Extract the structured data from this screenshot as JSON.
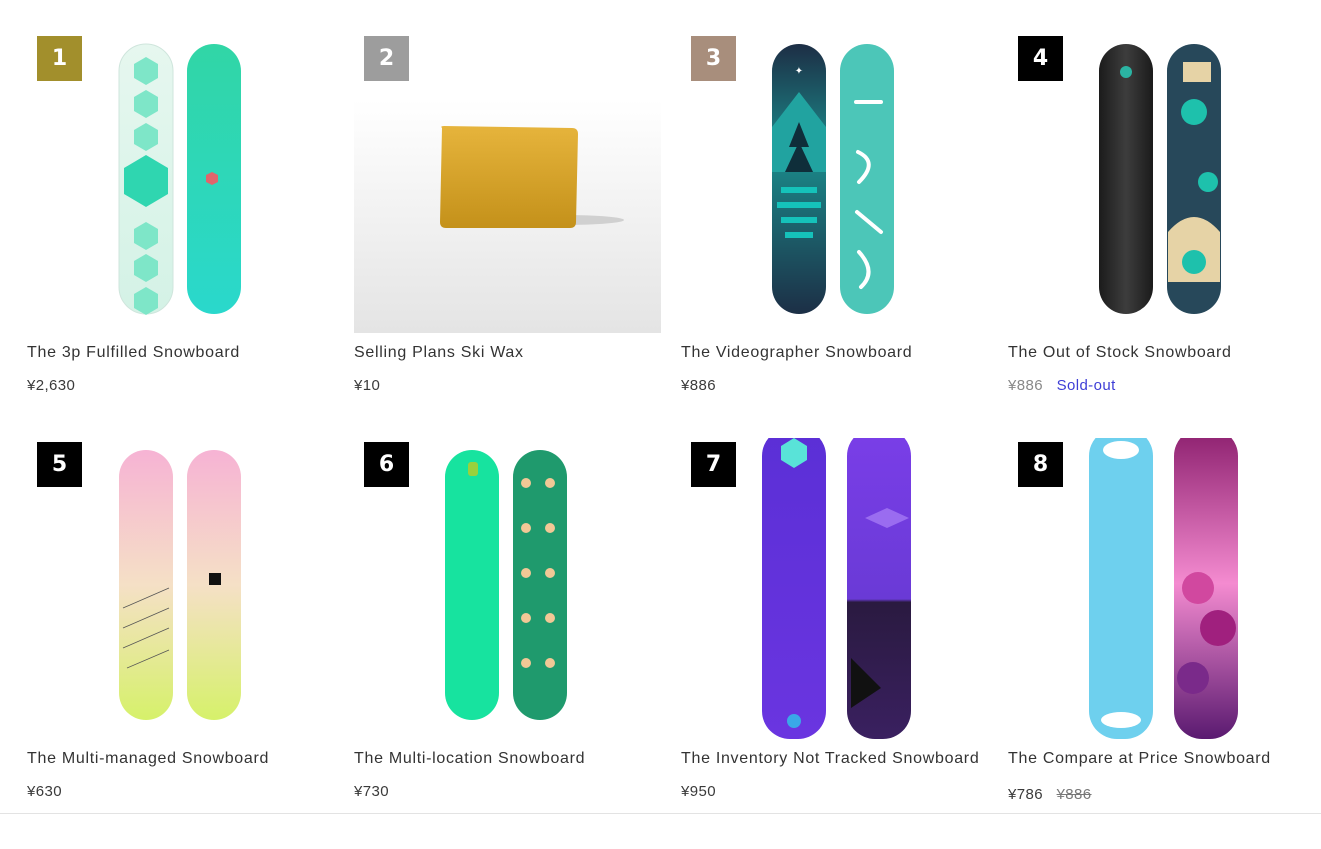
{
  "colors": {
    "rank_1": "#A28F2C",
    "rank_2": "#9D9D9D",
    "rank_3": "#A88E7C",
    "rank_default": "#000000",
    "sold_out": "#3D3DD6"
  },
  "products": [
    {
      "rank": "1",
      "title": "The 3p Fulfilled Snowboard",
      "price": "¥2,630",
      "image": "snowboard-mint-hexagon"
    },
    {
      "rank": "2",
      "title": "Selling Plans Ski Wax",
      "price": "¥10",
      "image": "wax-bar"
    },
    {
      "rank": "3",
      "title": "The Videographer Snowboard",
      "price": "¥886",
      "image": "snowboard-hydrogen"
    },
    {
      "rank": "4",
      "title": "The Out of Stock Snowboard",
      "price": "¥886",
      "status": "Sold-out",
      "image": "snowboard-black-teal"
    },
    {
      "rank": "5",
      "title": "The Multi-managed Snowboard",
      "price": "¥630",
      "image": "snowboard-pastel-gradient"
    },
    {
      "rank": "6",
      "title": "The Multi-location Snowboard",
      "price": "¥730",
      "image": "snowboard-green-characters"
    },
    {
      "rank": "7",
      "title": "The Inventory Not Tracked Snowboard",
      "price": "¥950",
      "image": "snowboard-purple-grid"
    },
    {
      "rank": "8",
      "title": "The Compare at Price Snowboard",
      "price": "¥786",
      "compare_price": "¥886",
      "image": "snowboard-blue-pink-clouds"
    }
  ]
}
